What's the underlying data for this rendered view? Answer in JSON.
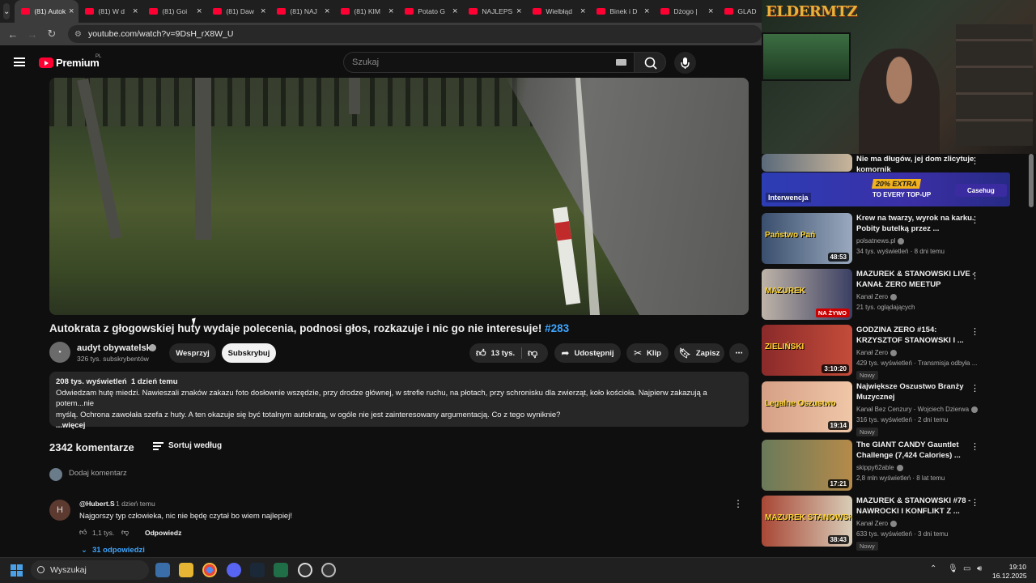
{
  "browser": {
    "tabs": [
      {
        "title": "(81) Autok",
        "active": true
      },
      {
        "title": "(81) W d"
      },
      {
        "title": "(81) Goi"
      },
      {
        "title": "(81) Daw"
      },
      {
        "title": "(81) NAJ"
      },
      {
        "title": "(81) KIM"
      },
      {
        "title": "Potato G"
      },
      {
        "title": "NAJLEPS"
      },
      {
        "title": "Wielbłąd"
      },
      {
        "title": "Binek i D"
      },
      {
        "title": "Dżogo |"
      },
      {
        "title": "GLAD"
      }
    ],
    "url": "youtube.com/watch?v=9DsH_rX8W_U"
  },
  "youtube": {
    "logo_text": "Premium",
    "country": "PL",
    "search_placeholder": "Szukaj",
    "video": {
      "title": "Autokrata z głogowskiej huty wydaje polecenia, podnosi głos, rozkazuje i nic go nie interesuje!",
      "hashtag": "#283",
      "channel": "audyt obywatelski",
      "subscribers": "326 tys. subskrybentów",
      "support_label": "Wesprzyj",
      "subscribe_label": "Subskrybuj",
      "likes": "13 tys.",
      "share_label": "Udostępnij",
      "clip_label": "Klip",
      "save_label": "Zapisz",
      "description": {
        "views": "208 tys. wyświetleń",
        "date": "1 dzień temu",
        "line1": "Odwiedzam hutę miedzi. Nawieszali znaków zakazu foto dosłownie wszędzie, przy drodze głównej, w strefie ruchu, na płotach, przy schronisku dla zwierząt, koło kościoła. Najpierw zakazują a potem...nie",
        "line2": "myślą. Ochrona zawołała szefa z huty. A ten okazuje się być totalnym autokratą, w ogóle nie jest zainteresowany argumentacją. Co z tego wyniknie?",
        "more": "...więcej"
      }
    },
    "comments": {
      "count": "2342 komentarze",
      "sort_label": "Sortuj według",
      "add_placeholder": "Dodaj komentarz",
      "items": [
        {
          "avatar_letter": "H",
          "author": "@Hubert.S",
          "time": "1 dzień temu",
          "text": "Najgorszy typ człowieka, nic nie będę czytał bo wiem najlepiej!",
          "likes": "1,1 tys.",
          "reply_label": "Odpowiedz",
          "replies": "31 odpowiedzi"
        }
      ]
    },
    "suggestions": [
      {
        "title": "Nie ma długów, jej dom zlicytuje komornik",
        "thumb_label": "Interwencja"
      },
      {
        "title": "Krew na twarzy, wyrok na karku. Pobity butelką przez ...",
        "channel": "polsatnews.pl",
        "stats": "34 tys. wyświetleń · 8 dni temu",
        "duration": "48:53",
        "thumb_label": "Państwo Pań"
      },
      {
        "title": "MAZUREK & STANOWSKI LIVE - KANAŁ ZERO MEETUP",
        "channel": "Kanał Zero",
        "stats": "21 tys. oglądających",
        "live": "NA ŻYWO",
        "thumb_label": "MAZUREK"
      },
      {
        "title": "GODZINA ZERO #154: KRZYSZTOF STANOWSKI I ...",
        "channel": "Kanał Zero",
        "stats": "429 tys. wyświetleń · Transmisja odbyła ...",
        "badge": "Nowy",
        "duration": "3:10:20",
        "thumb_label": "ZIELIŃSKI"
      },
      {
        "title": "Największe Oszustwo Branży Muzycznej",
        "channel": "Kanał Bez Cenzury - Wojciech Dzierwa",
        "stats": "316 tys. wyświetleń · 2 dni temu",
        "badge": "Nowy",
        "duration": "19:14",
        "thumb_label": "Legalne Oszustwo"
      },
      {
        "title": "The GIANT CANDY Gauntlet Challenge (7,424 Calories) ...",
        "channel": "skippy62able",
        "stats": "2,8 mln wyświetleń · 8 lat temu",
        "duration": "17:21"
      },
      {
        "title": "MAZUREK & STANOWSKI #78 - NAWROCKI I KONFLIKT Z ...",
        "channel": "Kanał Zero",
        "stats": "633 tys. wyświetleń · 3 dni temu",
        "badge": "Nowy",
        "duration": "38:43",
        "thumb_label": "MAZUREK STANOWSKI"
      }
    ],
    "ad": {
      "badge": "20% EXTRA",
      "line": "TO EVERY TOP-UP",
      "brand": "Casehug"
    }
  },
  "stream": {
    "logo": "ELDERMTZ"
  },
  "taskbar": {
    "search_label": "Wyszukaj",
    "time": "19:10",
    "date": "16.12.2025"
  }
}
